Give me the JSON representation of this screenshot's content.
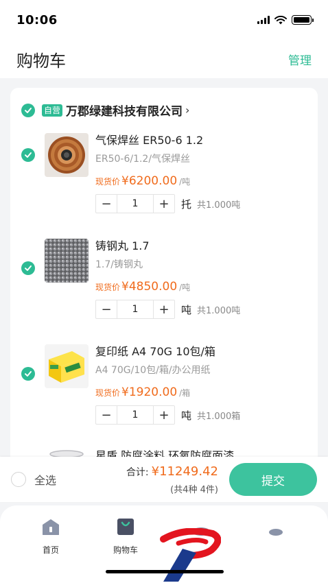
{
  "status": {
    "time": "10:06"
  },
  "nav": {
    "title": "购物车",
    "manage": "管理"
  },
  "store": {
    "tag": "自营",
    "name": "万郡绿建科技有限公司",
    "chevron": "›"
  },
  "items": [
    {
      "name": "气保焊丝 ER50-6 1.2",
      "spec": "ER50-6/1.2/气保焊丝",
      "price_label": "现货价",
      "price": "¥6200.00",
      "price_unit": "/吨",
      "qty": "1",
      "qty_unit": "托",
      "qty_total": "共1.000吨",
      "selected": true
    },
    {
      "name": "铸钢丸 1.7",
      "spec": "1.7/铸钢丸",
      "price_label": "现货价",
      "price": "¥4850.00",
      "price_unit": "/吨",
      "qty": "1",
      "qty_unit": "吨",
      "qty_total": "共1.000吨",
      "selected": true
    },
    {
      "name": "复印纸 A4 70G 10包/箱",
      "spec": "A4 70G/10包/箱/办公用纸",
      "price_label": "现货价",
      "price": "¥1920.00",
      "price_unit": "/箱",
      "qty": "1",
      "qty_unit": "吨",
      "qty_total": "共1.000箱",
      "selected": true
    },
    {
      "name": "星盾 防腐涂料 环氧防腐面漆"
    }
  ],
  "stepper": {
    "minus": "−",
    "plus": "+"
  },
  "bottom": {
    "select_all": "全选",
    "total_label": "合计:",
    "total_value": "¥11249.42",
    "total_sub": "(共4种 4件)",
    "submit": "提交"
  },
  "tabs": [
    {
      "label": "首页"
    },
    {
      "label": "购物车"
    }
  ],
  "colors": {
    "accent": "#2dbb94",
    "price": "#f06b1c"
  }
}
